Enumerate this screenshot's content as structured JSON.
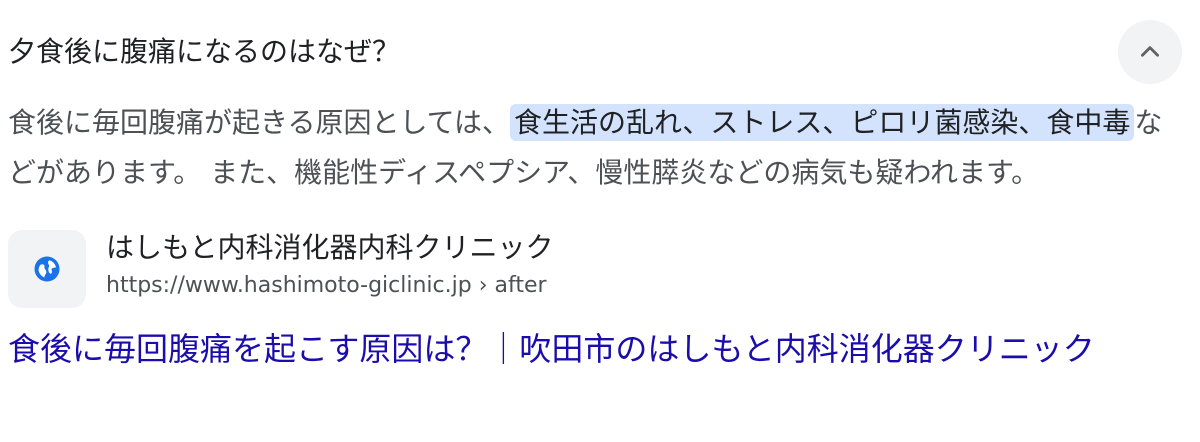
{
  "question": "夕食後に腹痛になるのはなぜ？",
  "answer": {
    "before": "食後に毎回腹痛が起きる原因としては、",
    "highlight": "食生活の乱れ、ストレス、ピロリ菌感染、食中毒",
    "after": "などがあります。 また、機能性ディスペプシア、慢性膵炎などの病気も疑われます。"
  },
  "source": {
    "site_name": "はしもと内科消化器内科クリニック",
    "url": "https://www.hashimoto-giclinic.jp › after",
    "favicon": "globe-icon"
  },
  "result": {
    "title": "食後に毎回腹痛を起こす原因は？｜吹田市のはしもと内科消化器クリニック"
  },
  "controls": {
    "collapse_icon": "chevron-up-icon"
  },
  "colors": {
    "link": "#1a0dab",
    "highlight": "#d3e3fd",
    "favicon": "#1a73e8"
  }
}
